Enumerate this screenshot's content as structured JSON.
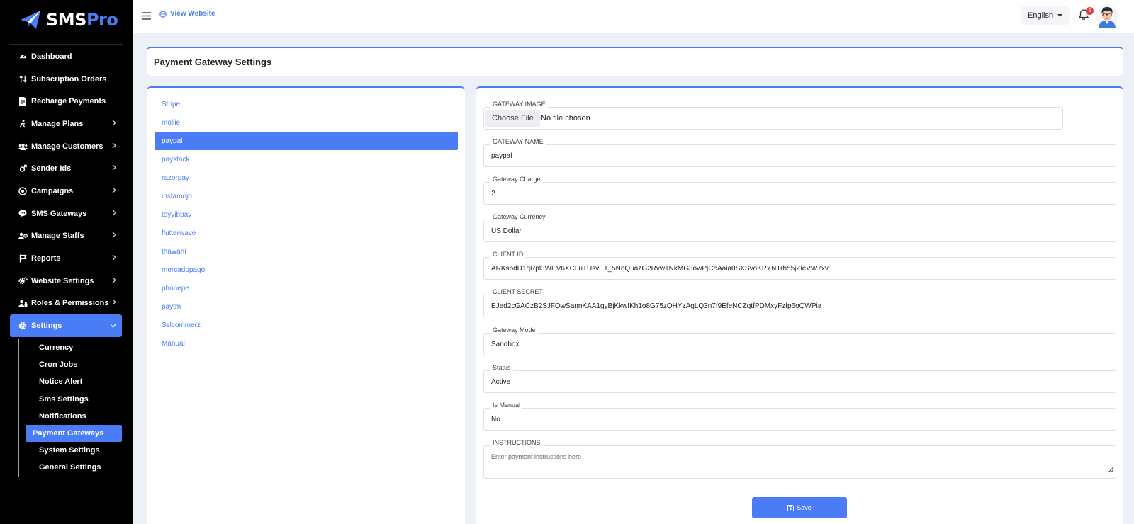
{
  "brand": {
    "part1": "SMS",
    "part2": "Pro"
  },
  "sidebar": {
    "items": [
      {
        "label": "Dashboard",
        "icon": "dashboard-icon"
      },
      {
        "label": "Subscription Orders",
        "icon": "sort-icon"
      },
      {
        "label": "Recharge Payments",
        "icon": "file-invoice-icon"
      },
      {
        "label": "Manage Plans",
        "icon": "walking-icon"
      },
      {
        "label": "Manage Customers",
        "icon": "users-icon"
      },
      {
        "label": "Sender Ids",
        "icon": "gender-icon"
      },
      {
        "label": "Campaigns",
        "icon": "bullseye-icon"
      },
      {
        "label": "SMS Gateways",
        "icon": "chat-icon"
      },
      {
        "label": "Manage Staffs",
        "icon": "staff-icon"
      },
      {
        "label": "Reports",
        "icon": "flag-icon"
      },
      {
        "label": "Website Settings",
        "icon": "cogs-icon"
      },
      {
        "label": "Roles & Permissions",
        "icon": "user-lock-icon"
      },
      {
        "label": "Settings",
        "icon": "gear-icon"
      }
    ],
    "sub_items": [
      "Currency",
      "Cron Jobs",
      "Notice Alert",
      "Sms Settings",
      "Notifications",
      "Payment Gateways",
      "System Settings",
      "General Settings"
    ]
  },
  "topbar": {
    "view_website": "View Website",
    "language": "English",
    "notification_count": "6"
  },
  "page": {
    "title": "Payment Gateway Settings"
  },
  "gateways": [
    "Stripe",
    "mollie",
    "paypal",
    "paystack",
    "razorpay",
    "instamojo",
    "toyyibpay",
    "flutterwave",
    "thawani",
    "mercadopago",
    "phonepe",
    "paytm",
    "Sslcommerz",
    "Manual"
  ],
  "form": {
    "gateway_image": {
      "label": "GATEWAY IMAGE",
      "button": "Choose File",
      "status": "No file chosen"
    },
    "gateway_name": {
      "label": "GATEWAY NAME",
      "value": "paypal"
    },
    "gateway_charge": {
      "label": "Gateway Charge",
      "value": "2"
    },
    "gateway_currency": {
      "label": "Gateway Currency",
      "value": "US Dollar"
    },
    "client_id": {
      "label": "CLIENT ID",
      "value": "ARKsbdD1qRpl3WEV6XCLuTUsvE1_5NnQuazG2Rvw1NkMG3owPjCeAaia0SXSvoKPYNTrh55jZieVW7xv"
    },
    "client_secret": {
      "label": "CLIENT SECRET",
      "value": "EJed2cGACzB2SJFQwSannKAA1gyBjKkwIKh1o8G75zQHYzAgLQ3n7f9EfeNCZgtfPDMxyFzfp6oQWPia"
    },
    "gateway_mode": {
      "label": "Gateway Mode",
      "value": "Sandbox"
    },
    "status": {
      "label": "Status",
      "value": "Active"
    },
    "is_manual": {
      "label": "Is Manual",
      "value": "No"
    },
    "instructions": {
      "label": "INSTRUCTIONS",
      "placeholder": "Enter payment instructions here"
    },
    "save_label": "Save"
  }
}
